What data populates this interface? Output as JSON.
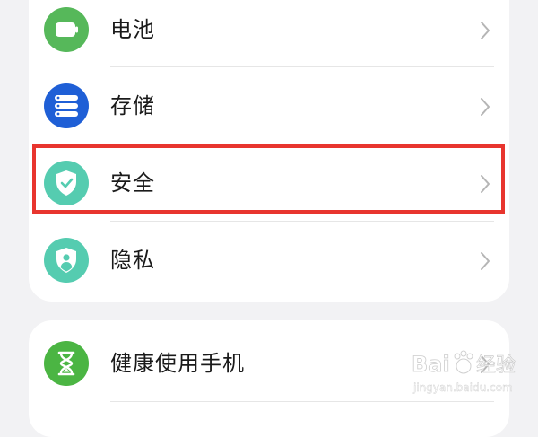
{
  "settings_group_1": {
    "items": [
      {
        "label": "电池",
        "icon": "battery-icon",
        "color": "#56b85a"
      },
      {
        "label": "存储",
        "icon": "storage-icon",
        "color": "#1f5fd6"
      },
      {
        "label": "安全",
        "icon": "shield-check-icon",
        "color": "#55ccb0"
      },
      {
        "label": "隐私",
        "icon": "privacy-shield-icon",
        "color": "#55ccb0"
      }
    ]
  },
  "settings_group_2": {
    "items": [
      {
        "label": "健康使用手机",
        "icon": "hourglass-icon",
        "color": "#4bb543"
      }
    ]
  },
  "highlighted_item": "安全",
  "highlight_color": "#e8352e",
  "watermark": {
    "brand": "Baidu 经验",
    "url": "jingyan.baidu.com"
  }
}
